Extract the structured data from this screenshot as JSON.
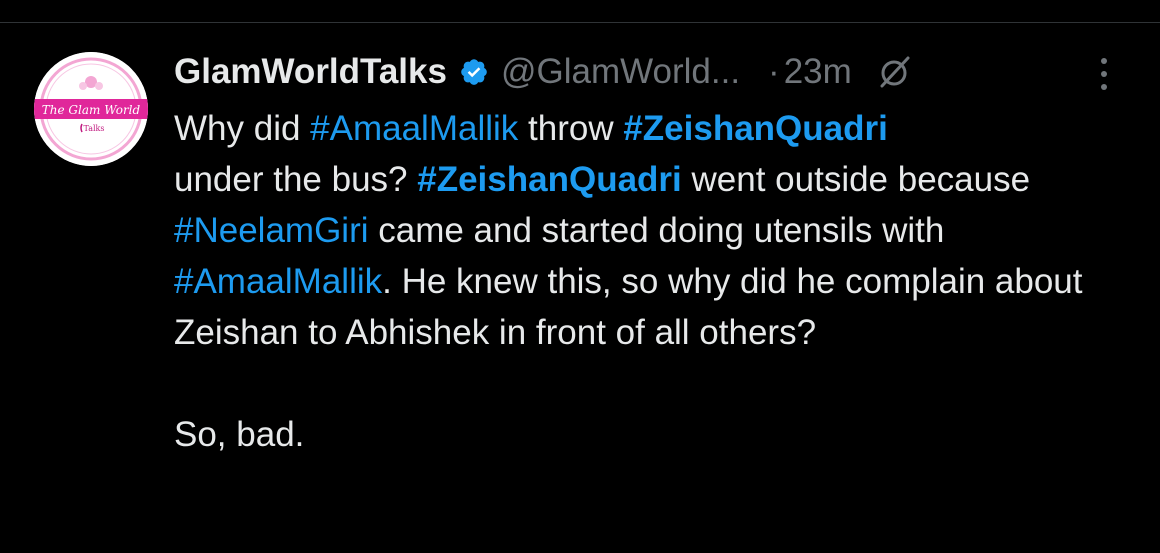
{
  "tweet": {
    "avatar": {
      "logo_text_top": "The Glam World",
      "logo_text_bottom": "Talks"
    },
    "author": {
      "display_name": "GlamWorldTalks",
      "handle": "@GlamWorld...",
      "verified": true,
      "verified_icon": "verified-badge-icon"
    },
    "separator": "·",
    "timestamp": "23m",
    "grok_icon": "grok-icon",
    "more_icon": "more-vertical-icon",
    "body": {
      "seg1": "Why did ",
      "tag1": "#AmaalMallik",
      "seg2": " throw ",
      "tag2": "#ZeishanQuadri",
      "seg3": "under the bus? ",
      "tag3": "#ZeishanQuadri",
      "seg4": " went outside because ",
      "tag4": "#NeelamGiri",
      "seg5": " came and started doing utensils with ",
      "tag5": "#AmaalMallik",
      "seg6": ". He knew this, so why did he complain about Zeishan to Abhishek in front of all others?",
      "closing": "So, bad."
    }
  },
  "colors": {
    "background": "#000000",
    "text": "#e7e9ea",
    "muted": "#71767b",
    "link": "#1d9bf0",
    "divider": "#2f3336",
    "logo_pink": "#e0279a"
  }
}
